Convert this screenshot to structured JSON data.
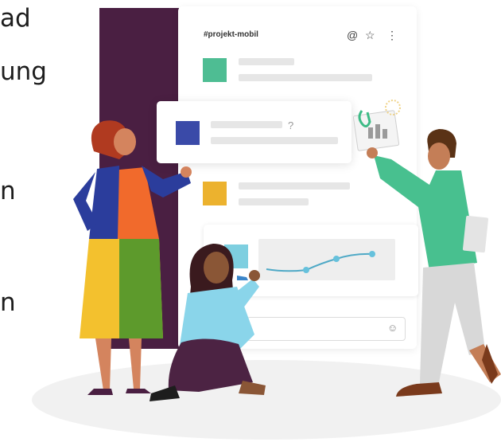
{
  "slide": {
    "lines": [
      "ad",
      "ung",
      "n",
      "n"
    ]
  },
  "channel": {
    "name": "#projekt-mobil",
    "icons": [
      "at-icon",
      "star-icon",
      "more-vertical-icon"
    ]
  },
  "question_mark": "?",
  "colors": {
    "sidebar": "#4a1f42",
    "green": "#4ebd93",
    "blue": "#3a4aa8",
    "yellow": "#ecb22e",
    "teal": "#7ecfe0"
  }
}
